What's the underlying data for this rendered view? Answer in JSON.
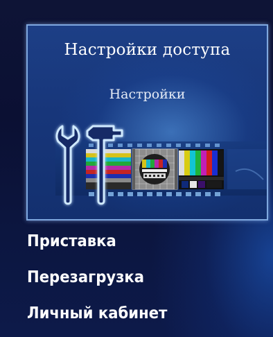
{
  "tile": {
    "title": "Настройки доступа",
    "subtitle": "Настройки",
    "icon": "wrench-hammer-test-pattern-icon"
  },
  "menu": {
    "items": [
      {
        "label": "Приставка"
      },
      {
        "label": "Перезагрузка"
      },
      {
        "label": "Личный кабинет"
      }
    ]
  },
  "colors": {
    "background": "#0b0f2e",
    "tile_border": "#7fa8df",
    "tile_fill": "#1d3f86",
    "text": "#ffffff"
  }
}
